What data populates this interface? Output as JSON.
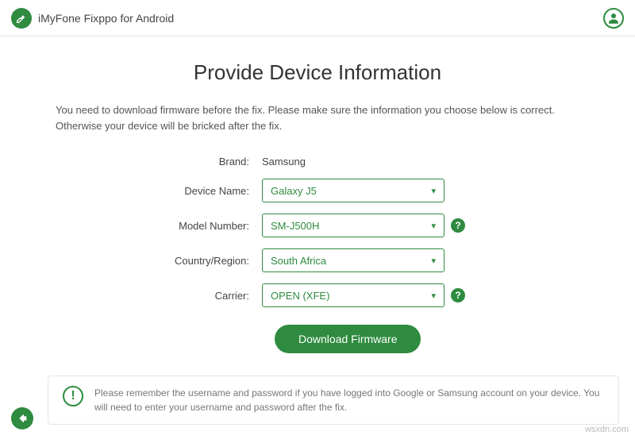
{
  "header": {
    "app_title": "iMyFone Fixppo for Android"
  },
  "page": {
    "title": "Provide Device Information",
    "instruction": "You need to download firmware before the fix. Please make sure the information you choose below is correct. Otherwise your device will be bricked after the fix."
  },
  "form": {
    "brand_label": "Brand:",
    "brand_value": "Samsung",
    "device_name_label": "Device Name:",
    "device_name_value": "Galaxy J5",
    "model_number_label": "Model Number:",
    "model_number_value": "SM-J500H",
    "country_label": "Country/Region:",
    "country_value": "South Africa",
    "carrier_label": "Carrier:",
    "carrier_value": "OPEN (XFE)",
    "download_btn": "Download Firmware"
  },
  "footer": {
    "note": "Please remember the username and password if you have logged into Google or Samsung account on your device. You will need to enter your username and password after the fix."
  },
  "watermark": "wsxdn.com"
}
